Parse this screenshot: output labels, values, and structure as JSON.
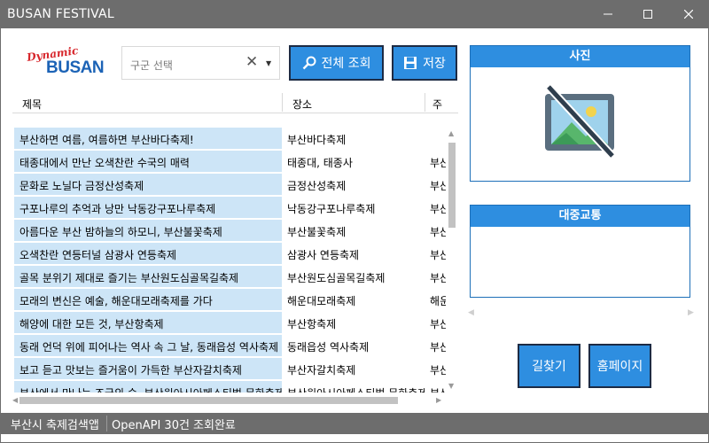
{
  "window": {
    "title": "BUSAN FESTIVAL"
  },
  "logo": {
    "top_text": "Dynamic",
    "main_text": "BUSAN"
  },
  "district_select": {
    "placeholder": "구군 선택"
  },
  "toolbar": {
    "search_all_label": "전체 조회",
    "save_label": "저장"
  },
  "table": {
    "columns": [
      "제목",
      "장소",
      "주"
    ],
    "rows": [
      {
        "title": "부산하면 여름, 여름하면 부산바다축제!",
        "place": "부산바다축제",
        "addr": ""
      },
      {
        "title": "태종대에서 만난 오색찬란 수국의 매력",
        "place": "태종대, 태종사",
        "addr": "부산"
      },
      {
        "title": "문화로 노닐다 금정산성축제",
        "place": "금정산성축제",
        "addr": "부산"
      },
      {
        "title": "구포나루의 추억과 낭만 낙동강구포나루축제",
        "place": "낙동강구포나루축제",
        "addr": "부산"
      },
      {
        "title": "아름다운 부산 밤하늘의 하모니, 부산불꽃축제",
        "place": "부산불꽃축제",
        "addr": "부산"
      },
      {
        "title": "오색찬란 연등터널 삼광사 연등축제",
        "place": "삼광사 연등축제",
        "addr": "부산"
      },
      {
        "title": "골목 분위기 제대로 즐기는 부산원도심골목길축제",
        "place": "부산원도심골목길축제",
        "addr": "부산"
      },
      {
        "title": "모래의 변신은 예술, 해운대모래축제를 가다",
        "place": "해운대모래축제",
        "addr": "해운"
      },
      {
        "title": "해양에 대한 모든 것, 부산항축제",
        "place": "부산항축제",
        "addr": "부산"
      },
      {
        "title": "동래 언덕 위에 피어나는 역사 속 그 날, 동래읍성 역사축제",
        "place": "동래읍성 역사축제",
        "addr": "부산"
      },
      {
        "title": "보고 듣고 맛보는 즐거움이 가득한 부산자갈치축제",
        "place": "부산자갈치축제",
        "addr": "부산"
      },
      {
        "title": "부산에서 만나는 조국의 숨, 부산원아시아페스티벌 문화축제",
        "place": "부산원아시아페스티벌 문화축제",
        "addr": "부산"
      }
    ]
  },
  "photo_panel": {
    "title": "사진",
    "image_icon": "image-off-icon"
  },
  "transit_panel": {
    "title": "대중교통"
  },
  "actions": {
    "directions_label": "길찾기",
    "homepage_label": "홈페이지"
  },
  "status": {
    "app_name": "부산시 축제검색앱",
    "message": "OpenAPI 30건 조회완료"
  },
  "colors": {
    "accent": "#2E8EE0",
    "row_highlight": "#CDE5F7",
    "chrome": "#6D6D6D"
  }
}
